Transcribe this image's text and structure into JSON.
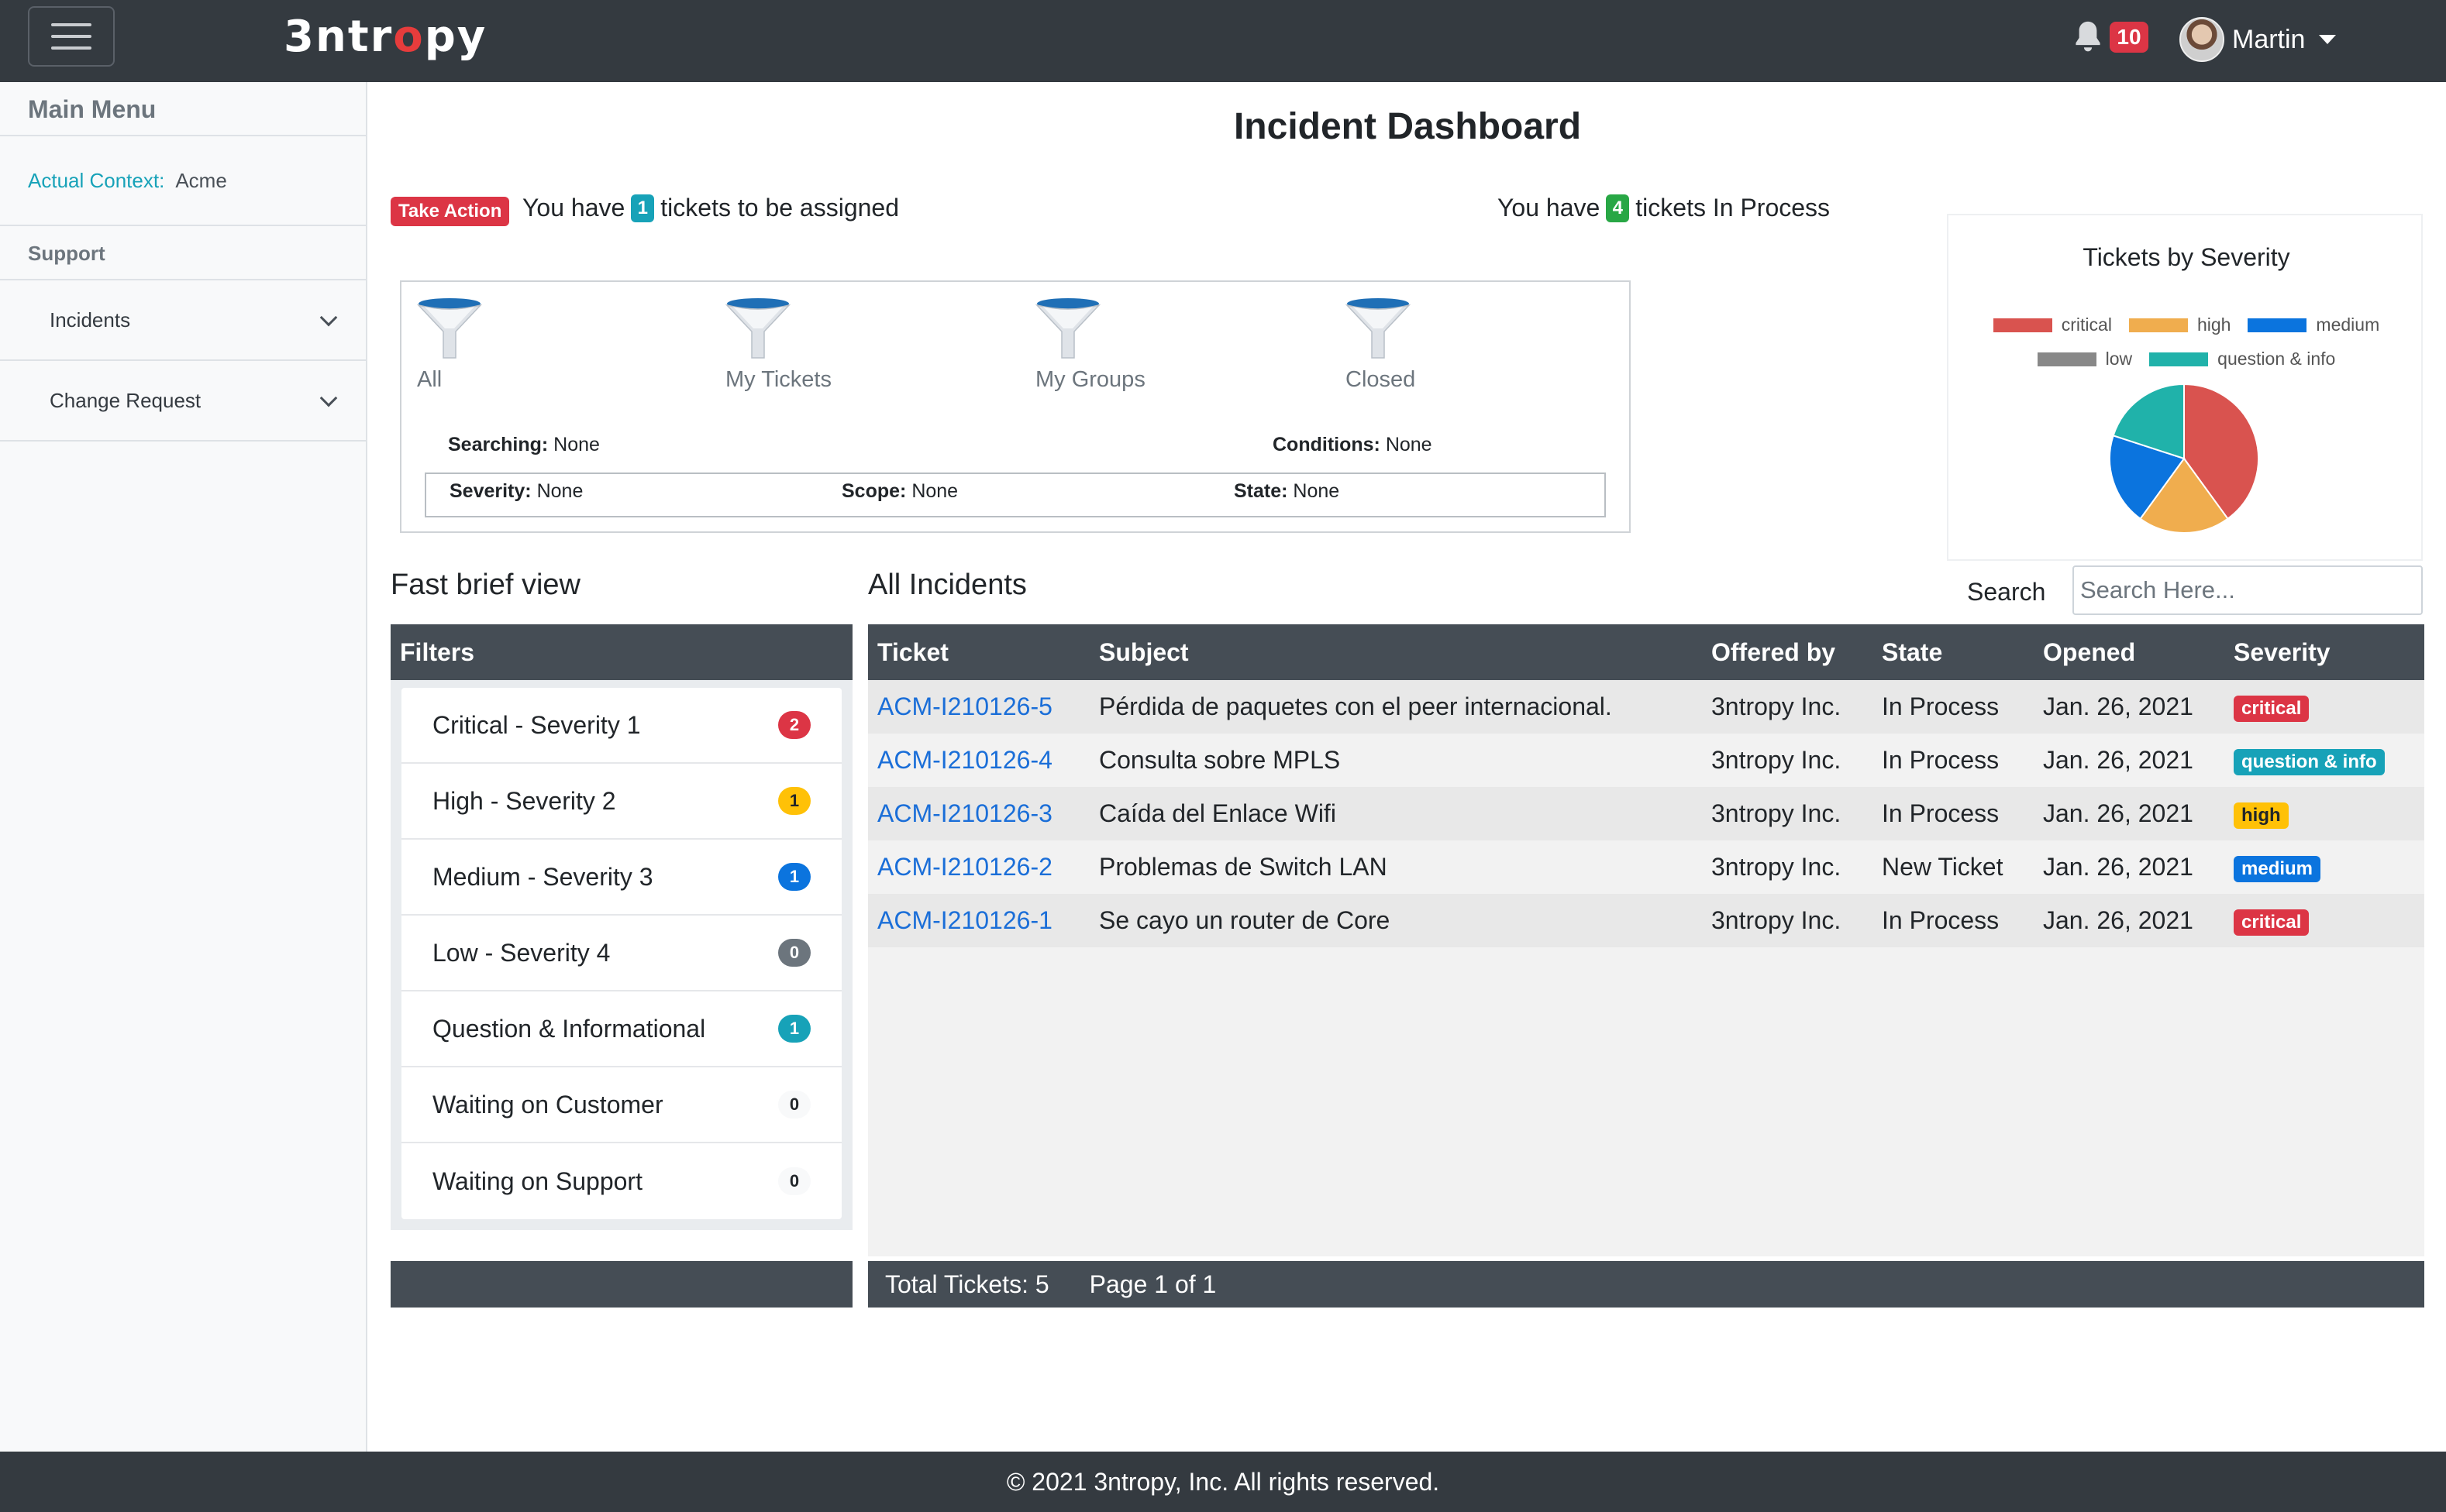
{
  "brand": {
    "text_pre": "3ntr",
    "text_o": "o",
    "text_post": "py"
  },
  "header": {
    "notification_count": "10",
    "user_name": "Martin"
  },
  "sidebar": {
    "title": "Main Menu",
    "context_label": "Actual Context:",
    "context_value": "Acme",
    "section": "Support",
    "items": [
      {
        "label": "Incidents"
      },
      {
        "label": "Change Request"
      }
    ]
  },
  "main": {
    "title": "Incident Dashboard",
    "take_action": "Take Action",
    "assign_msg_pre": "You have",
    "assign_count": "1",
    "assign_msg_post": "tickets to be assigned",
    "process_msg_pre": "You have",
    "process_count": "4",
    "process_msg_post": "tickets In Process"
  },
  "quick_filters": {
    "items": [
      {
        "label": "All"
      },
      {
        "label": "My Tickets"
      },
      {
        "label": "My Groups"
      },
      {
        "label": "Closed"
      }
    ],
    "searching_label": "Searching:",
    "searching_value": "None",
    "conditions_label": "Conditions:",
    "conditions_value": "None",
    "severity_label": "Severity:",
    "severity_value": "None",
    "scope_label": "Scope:",
    "scope_value": "None",
    "state_label": "State:",
    "state_value": "None"
  },
  "chart_data": {
    "type": "pie",
    "title": "Tickets by Severity",
    "labels": [
      "critical",
      "high",
      "medium",
      "low",
      "question & info"
    ],
    "values": [
      2,
      1,
      1,
      0,
      1
    ],
    "colors": [
      "#d9534f",
      "#f0ad4e",
      "#0b74de",
      "#888888",
      "#20b2aa"
    ],
    "legend_position": "top"
  },
  "search": {
    "label": "Search",
    "placeholder": "Search Here..."
  },
  "fast_view": {
    "title": "Fast brief view",
    "header": "Filters",
    "items": [
      {
        "label": "Critical - Severity 1",
        "count": "2",
        "color": "#dc3545",
        "text": "#ffffff"
      },
      {
        "label": "High - Severity 2",
        "count": "1",
        "color": "#ffc107",
        "text": "#212529"
      },
      {
        "label": "Medium - Severity 3",
        "count": "1",
        "color": "#0b74de",
        "text": "#ffffff"
      },
      {
        "label": "Low - Severity 4",
        "count": "0",
        "color": "#6c757d",
        "text": "#ffffff"
      },
      {
        "label": "Question & Informational",
        "count": "1",
        "color": "#17a2b8",
        "text": "#ffffff"
      },
      {
        "label": "Waiting on Customer",
        "count": "0",
        "color": "#f8f9fa",
        "text": "#212529"
      },
      {
        "label": "Waiting on Support",
        "count": "0",
        "color": "#f8f9fa",
        "text": "#212529"
      }
    ]
  },
  "incidents": {
    "title": "All Incidents",
    "columns": [
      "Ticket",
      "Subject",
      "Offered by",
      "State",
      "Opened",
      "Severity"
    ],
    "rows": [
      {
        "ticket": "ACM-I210126-5",
        "subject": "Pérdida de paquetes con el peer internacional.",
        "offered_by": "3ntropy Inc.",
        "state": "In Process",
        "opened": "Jan. 26, 2021",
        "severity": "critical",
        "sev_color": "#dc3545",
        "sev_text": "#ffffff"
      },
      {
        "ticket": "ACM-I210126-4",
        "subject": "Consulta sobre MPLS",
        "offered_by": "3ntropy Inc.",
        "state": "In Process",
        "opened": "Jan. 26, 2021",
        "severity": "question & info",
        "sev_color": "#17a2b8",
        "sev_text": "#ffffff"
      },
      {
        "ticket": "ACM-I210126-3",
        "subject": "Caída del Enlace Wifi",
        "offered_by": "3ntropy Inc.",
        "state": "In Process",
        "opened": "Jan. 26, 2021",
        "severity": "high",
        "sev_color": "#ffc107",
        "sev_text": "#212529"
      },
      {
        "ticket": "ACM-I210126-2",
        "subject": "Problemas de Switch LAN",
        "offered_by": "3ntropy Inc.",
        "state": "New Ticket",
        "opened": "Jan. 26, 2021",
        "severity": "medium",
        "sev_color": "#0b74de",
        "sev_text": "#ffffff"
      },
      {
        "ticket": "ACM-I210126-1",
        "subject": "Se cayo un router de Core",
        "offered_by": "3ntropy Inc.",
        "state": "In Process",
        "opened": "Jan. 26, 2021",
        "severity": "critical",
        "sev_color": "#dc3545",
        "sev_text": "#ffffff"
      }
    ],
    "total_text": "Total Tickets: 5",
    "page_text": "Page 1 of 1"
  },
  "footer": {
    "text": "© 2021 3ntropy, Inc. All rights reserved."
  }
}
